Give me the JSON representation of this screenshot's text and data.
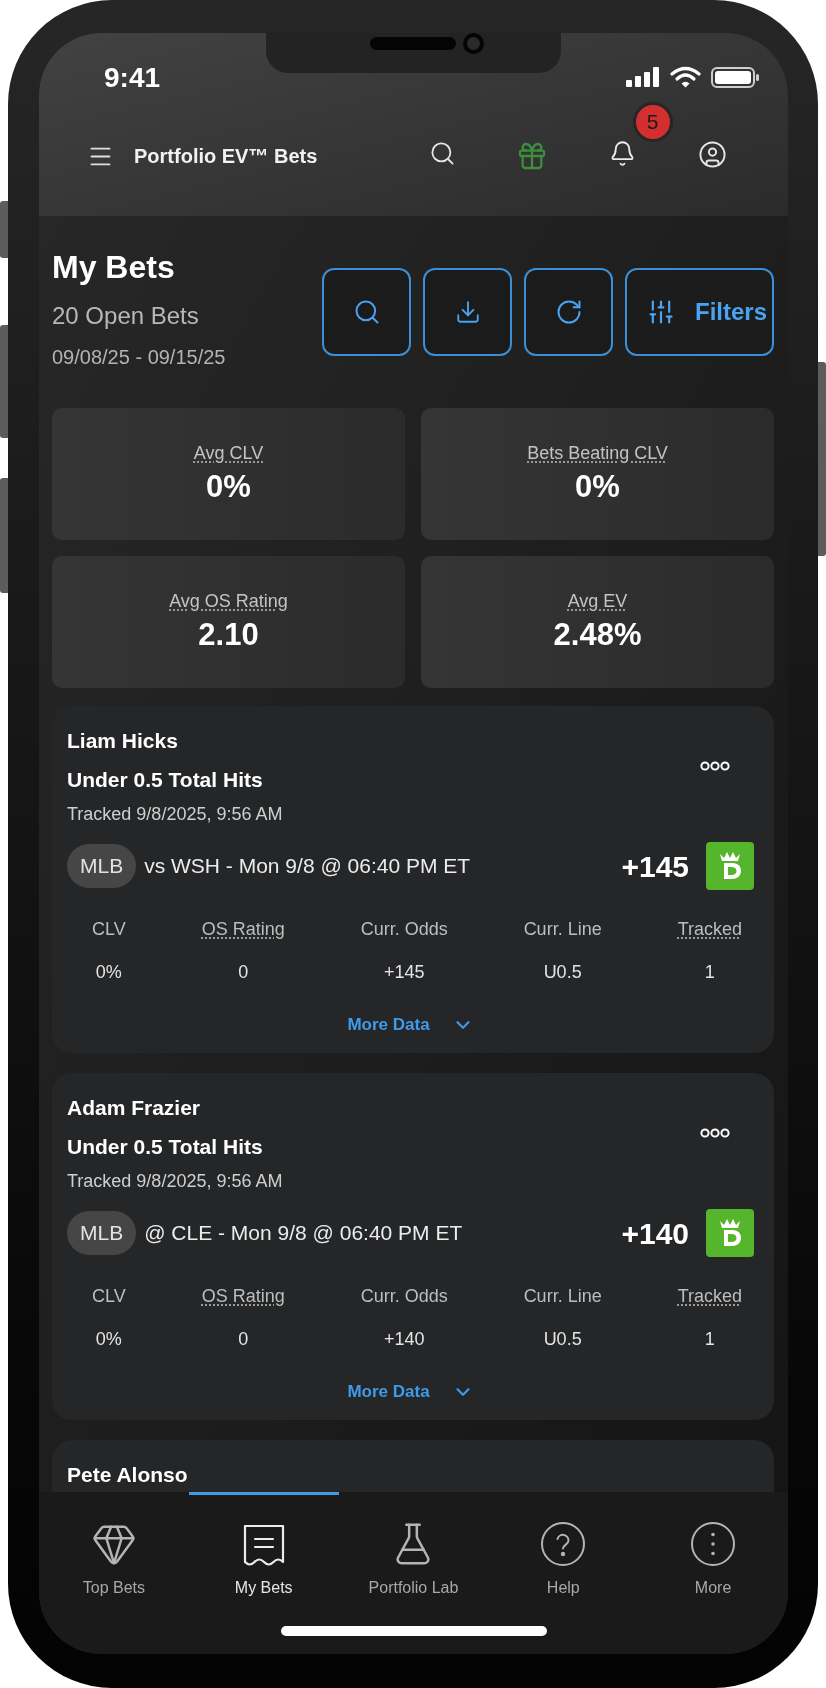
{
  "status_bar": {
    "time": "9:41"
  },
  "header": {
    "title": "Portfolio EV™ Bets",
    "notification_count": "5"
  },
  "summary_header": {
    "title": "My Bets",
    "count": "20 Open Bets",
    "date_range": "09/08/25 - 09/15/25"
  },
  "actions": [
    {
      "kind": "search"
    },
    {
      "kind": "download"
    },
    {
      "kind": "refresh"
    },
    {
      "kind": "filters",
      "label": "Filters"
    }
  ],
  "summary_stats": [
    {
      "label": "Avg CLV",
      "value": "0%"
    },
    {
      "label": "Bets Beating CLV",
      "value": "0%"
    },
    {
      "label": "Avg OS Rating",
      "value": "2.10"
    },
    {
      "label": "Avg EV",
      "value": "2.48%"
    }
  ],
  "bets": [
    {
      "player": "Liam Hicks",
      "market": "Under 0.5 Total Hits",
      "tracked": "Tracked 9/8/2025, 9:56 AM",
      "league": "MLB",
      "game": "vs WSH - Mon 9/8 @ 06:40 PM ET",
      "odds": "+145",
      "metrics": [
        {
          "label": "CLV",
          "value": "0%",
          "underlined": false
        },
        {
          "label": "OS Rating",
          "value": "0",
          "underlined": true
        },
        {
          "label": "Curr. Odds",
          "value": "+145",
          "underlined": false
        },
        {
          "label": "Curr. Line",
          "value": "U0.5",
          "underlined": false
        },
        {
          "label": "Tracked",
          "value": "1",
          "underlined": true
        }
      ],
      "more_label": "More Data"
    },
    {
      "player": "Adam Frazier",
      "market": "Under 0.5 Total Hits",
      "tracked": "Tracked 9/8/2025, 9:56 AM",
      "league": "MLB",
      "game": "@ CLE - Mon 9/8 @ 06:40 PM ET",
      "odds": "+140",
      "metrics": [
        {
          "label": "CLV",
          "value": "0%",
          "underlined": false
        },
        {
          "label": "OS Rating",
          "value": "0",
          "underlined": true
        },
        {
          "label": "Curr. Odds",
          "value": "+140",
          "underlined": false
        },
        {
          "label": "Curr. Line",
          "value": "U0.5",
          "underlined": false
        },
        {
          "label": "Tracked",
          "value": "1",
          "underlined": true
        }
      ],
      "more_label": "More Data"
    },
    {
      "player": "Pete Alonso"
    }
  ],
  "bottom_nav": [
    {
      "label": "Top Bets",
      "kind": "diamond",
      "selected": false
    },
    {
      "label": "My Bets",
      "kind": "receipt",
      "selected": true
    },
    {
      "label": "Portfolio Lab",
      "kind": "flask",
      "selected": false
    },
    {
      "label": "Help",
      "kind": "help",
      "selected": false
    },
    {
      "label": "More",
      "kind": "more",
      "selected": false
    }
  ]
}
